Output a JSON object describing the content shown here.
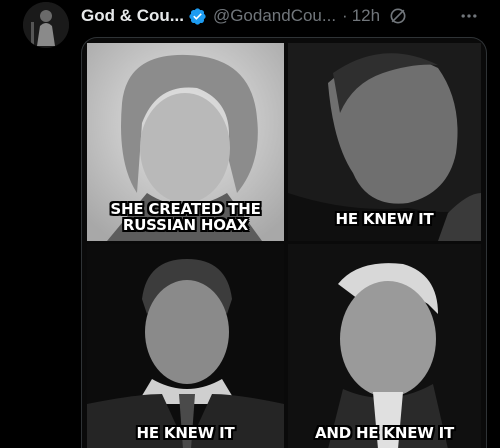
{
  "tweet": {
    "display_name": "God & Cou...",
    "handle": "@GodandCou...",
    "separator": "·",
    "timestamp": "12h",
    "verified_icon": "verified-badge-icon",
    "grok_icon": "grok-icon",
    "more_icon": "more-icon"
  },
  "meme": {
    "panels": [
      {
        "caption": "SHE CREATED THE RUSSIAN HOAX"
      },
      {
        "caption": "HE KNEW IT"
      },
      {
        "caption": "HE KNEW IT"
      },
      {
        "caption": "AND HE KNEW IT"
      }
    ]
  },
  "colors": {
    "background": "#000000",
    "text_primary": "#e7e9ea",
    "text_secondary": "#71767b",
    "verified": "#1d9bf0",
    "border": "#2f3336"
  }
}
